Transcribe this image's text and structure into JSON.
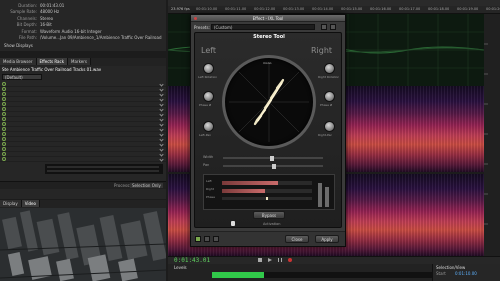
{
  "file_info": {
    "rows": [
      {
        "label": "Duration:",
        "value": "00:01:43.01"
      },
      {
        "label": "Sample Rate:",
        "value": "48000 Hz"
      },
      {
        "label": "Channels:",
        "value": "Stereo"
      },
      {
        "label": "Bit Depth:",
        "value": "16-Bit"
      },
      {
        "label": "Format:",
        "value": "Waveform Audio 16-bit Integer"
      },
      {
        "label": "File Path:",
        "value": "/Volume...Jan 09/Ambience_1/Ambience Traffic Over Railroad Tracks 01.wav"
      }
    ],
    "show_displays": "Show Displays"
  },
  "left_tabs": [
    "Media Browser",
    "Effects Rack",
    "Markers"
  ],
  "effects_rack": {
    "file": "Ste Ambience Traffic Over Railroad Tracks 01.wav",
    "preset": "(Default)",
    "slot_count": 16
  },
  "video_tabs": [
    "Display",
    "Video"
  ],
  "timeline": {
    "zoom": "23.976 fps",
    "ticks": [
      "00:01:10.00",
      "00:01:11.00",
      "00:01:12.00",
      "00:01:13.00",
      "00:01:14.00",
      "00:01:15.00",
      "00:01:16.00",
      "00:01:17.00",
      "00:01:18.00",
      "00:01:19.00",
      "00:01:20.00"
    ]
  },
  "transport": {
    "time": "0:01:43.01",
    "levels_label": "Levels"
  },
  "selection_panel": {
    "title": "Selection/View",
    "start_label": "Start",
    "start_value": "0:01:10.00"
  },
  "process_label": "Process:",
  "process_value": "Selection Only",
  "plugin": {
    "window_title": "Effect - IXL Tool",
    "presets_label": "Presets:",
    "preset_value": "(Custom)",
    "header": "Stereo Tool",
    "left": "Left",
    "right": "Right",
    "mono": "mono",
    "width_label": "Width",
    "pan_label": "Pan",
    "knob_labels_left": [
      "Left Rotation",
      "Phase Ø",
      "Left-Pan"
    ],
    "knob_labels_right": [
      "Right Rotation",
      "Phase Ø",
      "Right-Pan"
    ],
    "meter_rows": [
      "Left",
      "Right",
      "Phase"
    ],
    "bypass_label": "Bypass",
    "activation_label": "Activation",
    "close_button": "Close",
    "apply_button": "Apply",
    "meter_fill_left": 0.62,
    "meter_fill_right": 0.48
  },
  "colors": {
    "accent_green": "#7aa84d",
    "plugin_cream": "#efe7c4"
  }
}
